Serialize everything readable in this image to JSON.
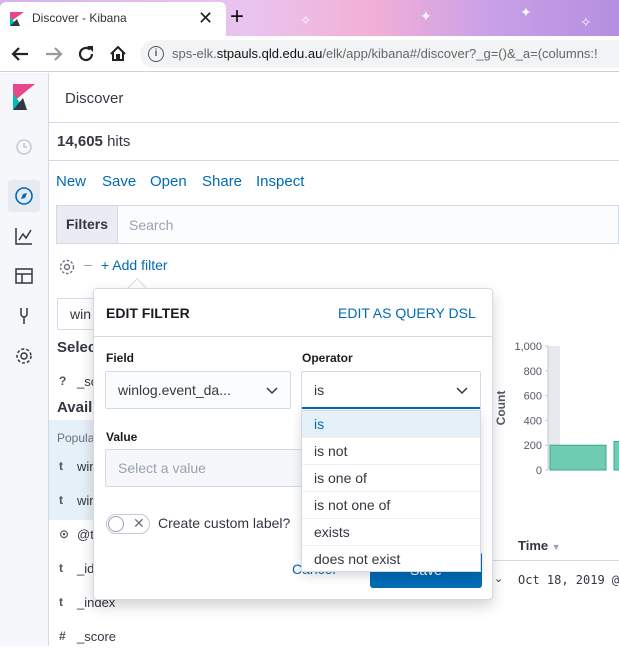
{
  "browser": {
    "tab_title": "Discover - Kibana",
    "url_prefix": "sps-elk.",
    "url_domain": "stpauls.qld.edu.au",
    "url_rest": "/elk/app/kibana#/discover?_g=()&_a=(columns:!"
  },
  "header": {
    "title": "Discover"
  },
  "hits": {
    "count": "14,605",
    "label": "hits"
  },
  "top_menu": [
    "New",
    "Save",
    "Open",
    "Share",
    "Inspect"
  ],
  "filter_bar": {
    "label": "Filters",
    "search_placeholder": "Search",
    "add_filter": "+ Add filter"
  },
  "sidebar": {
    "index_value": "win",
    "selected_heading": "Selec",
    "selected_fields": [
      {
        "type": "?",
        "name": "_sc"
      }
    ],
    "available_heading": "Avail",
    "popular_label": "Popula",
    "fields": [
      {
        "type": "t",
        "name": "win"
      },
      {
        "type": "t",
        "name": "win"
      },
      {
        "type": "⊙",
        "name": "@t"
      },
      {
        "type": "t",
        "name": "_id"
      },
      {
        "type": "t",
        "name": "_index"
      },
      {
        "type": "#",
        "name": "_score"
      }
    ]
  },
  "chart_data": {
    "type": "bar",
    "ylabel": "Count",
    "yticks": [
      "1,000",
      "800",
      "600",
      "400",
      "200",
      "0"
    ],
    "ylim": [
      0,
      1000
    ],
    "values": [
      200,
      230
    ]
  },
  "table": {
    "time_header": "Time",
    "first_time": "Oct 18, 2019 @"
  },
  "popover": {
    "title": "EDIT FILTER",
    "dsl_link": "EDIT AS QUERY DSL",
    "field_label": "Field",
    "field_value": "winlog.event_da...",
    "operator_label": "Operator",
    "operator_value": "is",
    "value_label": "Value",
    "value_placeholder": "Select a value",
    "custom_label": "Create custom label?",
    "cancel": "Cancel",
    "save": "Save"
  },
  "operator_options": [
    "is",
    "is not",
    "is one of",
    "is not one of",
    "exists",
    "does not exist"
  ],
  "colors": {
    "accent": "#006bb4",
    "bar": "#6dccb1"
  }
}
